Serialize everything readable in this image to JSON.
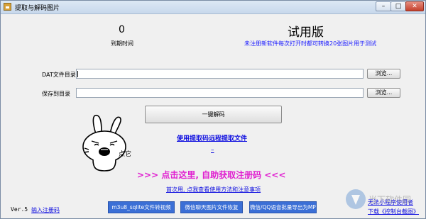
{
  "window": {
    "title": "提取与解码图片",
    "minimize": "–",
    "maximize": "□",
    "close": "✕"
  },
  "counter": {
    "value": "0",
    "label": "到期时间"
  },
  "trial": {
    "title": "试用版",
    "note": "未注册新软件每次打开时都可转换20张图片用于测试"
  },
  "fields": {
    "dat_dir_label": "DAT文件目录",
    "dat_dir_value": "",
    "save_dir_label": "保存到目录",
    "save_dir_value": "",
    "browse_label": "浏览..."
  },
  "decode_button": "一键解码",
  "links": {
    "remote": "使用提取码远程提取文件",
    "dash": "–",
    "register_banner": ">>>  点击这里, 自助获取注册码  <<<",
    "first_use": "首次用, 点我查看使用方法和注意事项"
  },
  "mascot": {
    "label": "点它"
  },
  "footer": {
    "version": "Ver.5",
    "enter_code": "输入注册码",
    "buttons": [
      "m3u8_sqlite文件转视频",
      "微信聊天图片文件恢复",
      "微信/QQ语音批量导出为MP3"
    ],
    "corner_lines": [
      "无法小程序使用者",
      "下载《控制台截图》"
    ]
  },
  "watermark": {
    "text": "当下软件园"
  },
  "colors": {
    "link": "#1010e0",
    "banner": "#e020d0",
    "blue_button": "#3b6fd6"
  }
}
